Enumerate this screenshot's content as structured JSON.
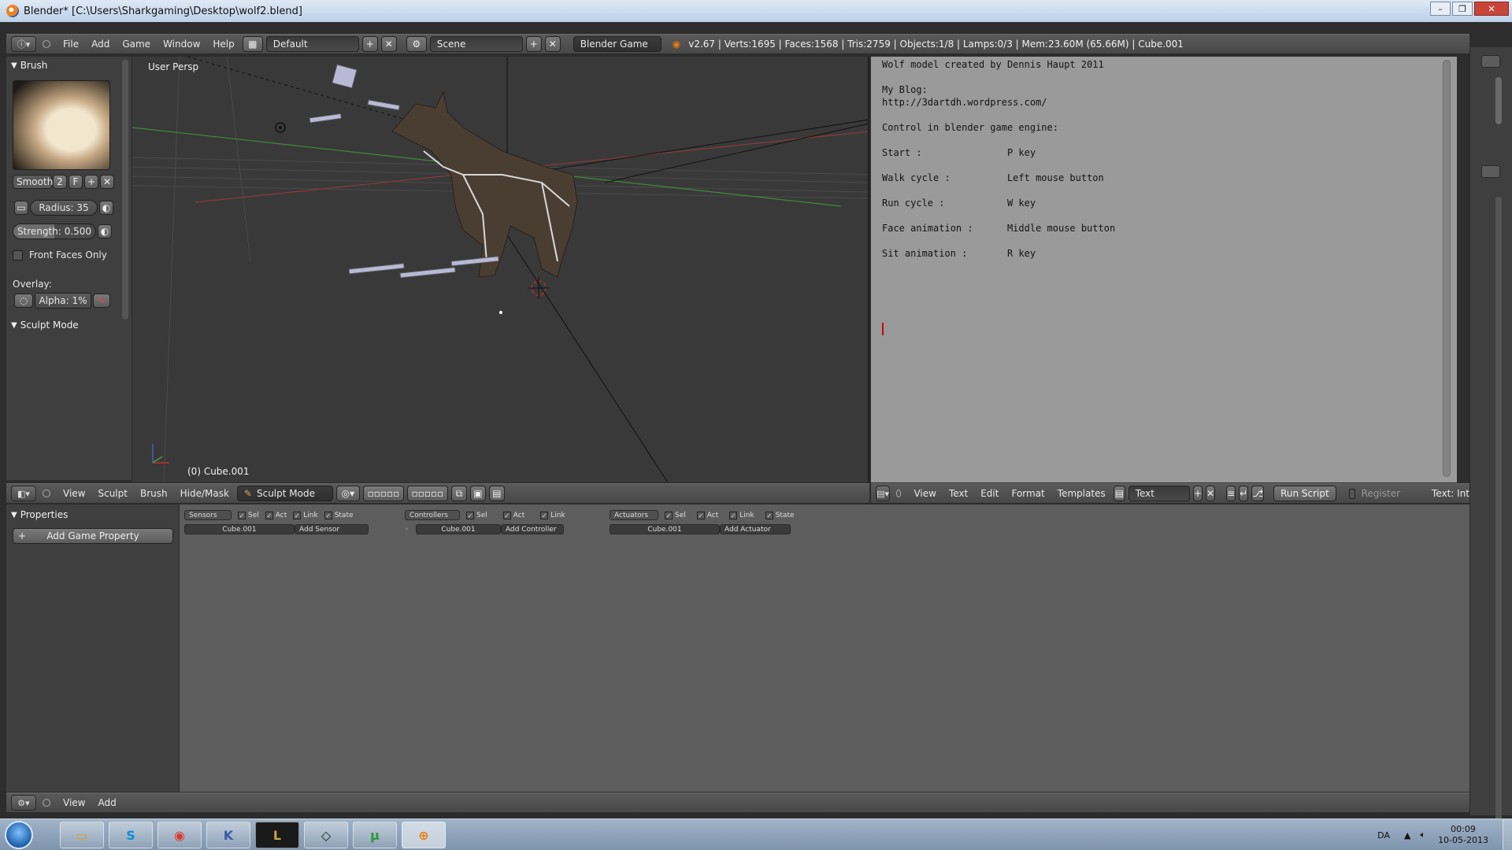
{
  "window": {
    "title": "Blender* [C:\\Users\\Sharkgaming\\Desktop\\wolf2.blend]"
  },
  "info_header": {
    "menus": [
      "File",
      "Add",
      "Game",
      "Window",
      "Help"
    ],
    "screen_layout": "Default",
    "scene": "Scene",
    "engine": "Blender Game",
    "stats": "v2.67 | Verts:1695 | Faces:1568 | Tris:2759 | Objects:1/8 | Lamps:0/3 | Mem:23.60M (65.66M) | Cube.001"
  },
  "tool_shelf": {
    "brush_title": "Brush",
    "brush_name": "Smooth",
    "brush_users": "2",
    "brush_fake": "F",
    "radius": "Radius: 35",
    "strength": "Strength: 0.500",
    "front_faces": "Front Faces Only",
    "overlay_label": "Overlay:",
    "alpha": "Alpha: 1%",
    "sculpt_mode_panel": "Sculpt Mode"
  },
  "viewport": {
    "view_label": "User Persp",
    "object_label": "(0) Cube.001"
  },
  "viewport_header": {
    "menus": [
      "View",
      "Sculpt",
      "Brush",
      "Hide/Mask"
    ],
    "mode": "Sculpt Mode"
  },
  "text_editor": {
    "lines": [
      "Wolf model created by Dennis Haupt 2011",
      "",
      "My Blog:",
      "http://3dartdh.wordpress.com/",
      "",
      "Control in blender game engine:",
      "",
      "Start :               P key",
      "",
      "Walk cycle :          Left mouse button",
      "",
      "Run cycle :           W key",
      "",
      "Face animation :      Middle mouse button",
      "",
      "Sit animation :       R key"
    ]
  },
  "text_header": {
    "menus": [
      "View",
      "Text",
      "Edit",
      "Format",
      "Templates"
    ],
    "text_name": "Text",
    "run_script": "Run Script",
    "register": "Register",
    "text_int": "Text: Int"
  },
  "logic": {
    "properties_title": "Properties",
    "add_property": "Add Game Property",
    "sensors": {
      "label": "Sensors",
      "object": "Cube.001",
      "add": "Add Sensor"
    },
    "controllers": {
      "label": "Controllers",
      "object": "Cube.001",
      "add": "Add Controller"
    },
    "actuators": {
      "label": "Actuators",
      "object": "Cube.001",
      "add": "Add Actuator"
    },
    "flags": {
      "sel": "Sel",
      "act": "Act",
      "link": "Link",
      "state": "State"
    }
  },
  "logic_header": {
    "menus": [
      "View",
      "Add"
    ]
  },
  "taskbar": {
    "apps": [
      "explorer",
      "skype",
      "chrome",
      "keepass",
      "league",
      "unity",
      "utorrent",
      "blender"
    ],
    "apps_glyph": [
      "▭",
      "S",
      "◉",
      "K",
      "L",
      "◇",
      "μ",
      "⊕"
    ],
    "lang": "DA",
    "time": "00:09",
    "date": "10-05-2013"
  },
  "colors": {
    "accent_orange": "#e87d0d",
    "viewport_bg": "#393939",
    "text_bg": "#9a9a9a",
    "cursor_red": "#d00000"
  }
}
